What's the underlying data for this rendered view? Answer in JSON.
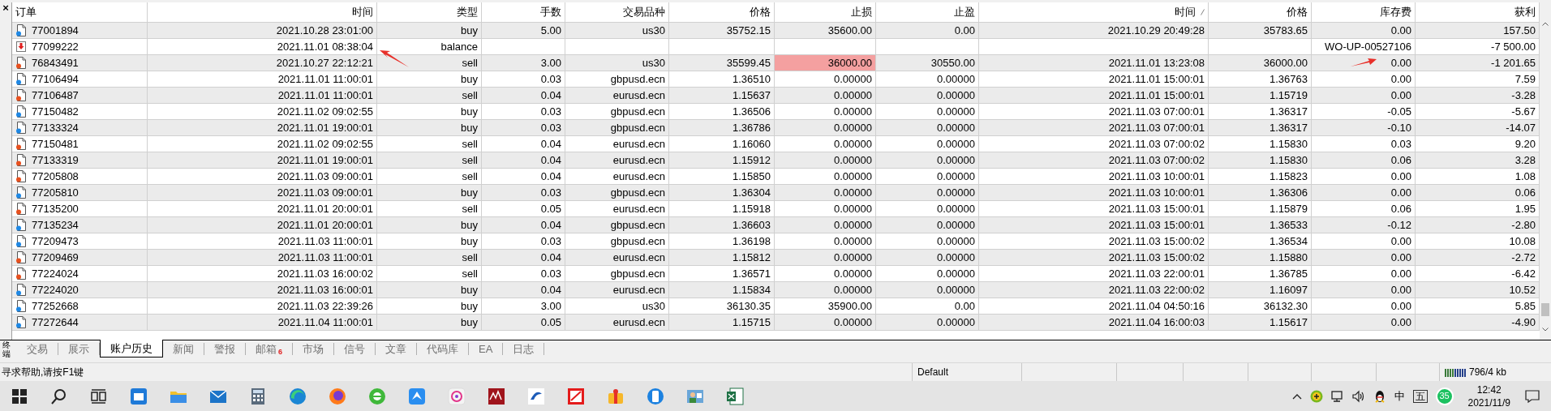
{
  "close_glyph": "×",
  "table": {
    "columns": [
      {
        "label": "订单",
        "sorted": false
      },
      {
        "label": "时间",
        "sorted": false
      },
      {
        "label": "类型",
        "sorted": false
      },
      {
        "label": "手数",
        "sorted": false
      },
      {
        "label": "交易品种",
        "sorted": false
      },
      {
        "label": "价格",
        "sorted": false
      },
      {
        "label": "止损",
        "sorted": false
      },
      {
        "label": "止盈",
        "sorted": false
      },
      {
        "label": "时间",
        "sorted": true
      },
      {
        "label": "价格",
        "sorted": false
      },
      {
        "label": "库存费",
        "sorted": false
      },
      {
        "label": "获利",
        "sorted": false
      }
    ],
    "rows": [
      {
        "kind": "buy",
        "sl_hit": false,
        "order": "77001894",
        "time": "2021.10.28 23:01:00",
        "type": "buy",
        "lots": "5.00",
        "symbol": "us30",
        "price": "35752.15",
        "sl": "35600.00",
        "tp": "0.00",
        "close_time": "2021.10.29 20:49:28",
        "close_price": "35783.65",
        "swap": "0.00",
        "profit": "157.50"
      },
      {
        "kind": "balance",
        "sl_hit": false,
        "order": "77099222",
        "time": "2021.11.01 08:38:04",
        "type": "balance",
        "swap": "WO-UP-00527106",
        "profit": "-7 500.00"
      },
      {
        "kind": "sell",
        "sl_hit": true,
        "order": "76843491",
        "time": "2021.10.27 22:12:21",
        "type": "sell",
        "lots": "3.00",
        "symbol": "us30",
        "price": "35599.45",
        "sl": "36000.00",
        "tp": "30550.00",
        "close_time": "2021.11.01 13:23:08",
        "close_price": "36000.00",
        "swap": "0.00",
        "profit": "-1 201.65"
      },
      {
        "kind": "buy",
        "sl_hit": false,
        "order": "77106494",
        "time": "2021.11.01 11:00:01",
        "type": "buy",
        "lots": "0.03",
        "symbol": "gbpusd.ecn",
        "price": "1.36510",
        "sl": "0.00000",
        "tp": "0.00000",
        "close_time": "2021.11.01 15:00:01",
        "close_price": "1.36763",
        "swap": "0.00",
        "profit": "7.59"
      },
      {
        "kind": "sell",
        "sl_hit": false,
        "order": "77106487",
        "time": "2021.11.01 11:00:01",
        "type": "sell",
        "lots": "0.04",
        "symbol": "eurusd.ecn",
        "price": "1.15637",
        "sl": "0.00000",
        "tp": "0.00000",
        "close_time": "2021.11.01 15:00:01",
        "close_price": "1.15719",
        "swap": "0.00",
        "profit": "-3.28"
      },
      {
        "kind": "buy",
        "sl_hit": false,
        "order": "77150482",
        "time": "2021.11.02 09:02:55",
        "type": "buy",
        "lots": "0.03",
        "symbol": "gbpusd.ecn",
        "price": "1.36506",
        "sl": "0.00000",
        "tp": "0.00000",
        "close_time": "2021.11.03 07:00:01",
        "close_price": "1.36317",
        "swap": "-0.05",
        "profit": "-5.67"
      },
      {
        "kind": "buy",
        "sl_hit": false,
        "order": "77133324",
        "time": "2021.11.01 19:00:01",
        "type": "buy",
        "lots": "0.03",
        "symbol": "gbpusd.ecn",
        "price": "1.36786",
        "sl": "0.00000",
        "tp": "0.00000",
        "close_time": "2021.11.03 07:00:01",
        "close_price": "1.36317",
        "swap": "-0.10",
        "profit": "-14.07"
      },
      {
        "kind": "sell",
        "sl_hit": false,
        "order": "77150481",
        "time": "2021.11.02 09:02:55",
        "type": "sell",
        "lots": "0.04",
        "symbol": "eurusd.ecn",
        "price": "1.16060",
        "sl": "0.00000",
        "tp": "0.00000",
        "close_time": "2021.11.03 07:00:02",
        "close_price": "1.15830",
        "swap": "0.03",
        "profit": "9.20"
      },
      {
        "kind": "sell",
        "sl_hit": false,
        "order": "77133319",
        "time": "2021.11.01 19:00:01",
        "type": "sell",
        "lots": "0.04",
        "symbol": "eurusd.ecn",
        "price": "1.15912",
        "sl": "0.00000",
        "tp": "0.00000",
        "close_time": "2021.11.03 07:00:02",
        "close_price": "1.15830",
        "swap": "0.06",
        "profit": "3.28"
      },
      {
        "kind": "sell",
        "sl_hit": false,
        "order": "77205808",
        "time": "2021.11.03 09:00:01",
        "type": "sell",
        "lots": "0.04",
        "symbol": "eurusd.ecn",
        "price": "1.15850",
        "sl": "0.00000",
        "tp": "0.00000",
        "close_time": "2021.11.03 10:00:01",
        "close_price": "1.15823",
        "swap": "0.00",
        "profit": "1.08"
      },
      {
        "kind": "buy",
        "sl_hit": false,
        "order": "77205810",
        "time": "2021.11.03 09:00:01",
        "type": "buy",
        "lots": "0.03",
        "symbol": "gbpusd.ecn",
        "price": "1.36304",
        "sl": "0.00000",
        "tp": "0.00000",
        "close_time": "2021.11.03 10:00:01",
        "close_price": "1.36306",
        "swap": "0.00",
        "profit": "0.06"
      },
      {
        "kind": "sell",
        "sl_hit": false,
        "order": "77135200",
        "time": "2021.11.01 20:00:01",
        "type": "sell",
        "lots": "0.05",
        "symbol": "eurusd.ecn",
        "price": "1.15918",
        "sl": "0.00000",
        "tp": "0.00000",
        "close_time": "2021.11.03 15:00:01",
        "close_price": "1.15879",
        "swap": "0.06",
        "profit": "1.95"
      },
      {
        "kind": "buy",
        "sl_hit": false,
        "order": "77135234",
        "time": "2021.11.01 20:00:01",
        "type": "buy",
        "lots": "0.04",
        "symbol": "gbpusd.ecn",
        "price": "1.36603",
        "sl": "0.00000",
        "tp": "0.00000",
        "close_time": "2021.11.03 15:00:01",
        "close_price": "1.36533",
        "swap": "-0.12",
        "profit": "-2.80"
      },
      {
        "kind": "buy",
        "sl_hit": false,
        "order": "77209473",
        "time": "2021.11.03 11:00:01",
        "type": "buy",
        "lots": "0.03",
        "symbol": "gbpusd.ecn",
        "price": "1.36198",
        "sl": "0.00000",
        "tp": "0.00000",
        "close_time": "2021.11.03 15:00:02",
        "close_price": "1.36534",
        "swap": "0.00",
        "profit": "10.08"
      },
      {
        "kind": "sell",
        "sl_hit": false,
        "order": "77209469",
        "time": "2021.11.03 11:00:01",
        "type": "sell",
        "lots": "0.04",
        "symbol": "eurusd.ecn",
        "price": "1.15812",
        "sl": "0.00000",
        "tp": "0.00000",
        "close_time": "2021.11.03 15:00:02",
        "close_price": "1.15880",
        "swap": "0.00",
        "profit": "-2.72"
      },
      {
        "kind": "sell",
        "sl_hit": false,
        "order": "77224024",
        "time": "2021.11.03 16:00:02",
        "type": "sell",
        "lots": "0.03",
        "symbol": "gbpusd.ecn",
        "price": "1.36571",
        "sl": "0.00000",
        "tp": "0.00000",
        "close_time": "2021.11.03 22:00:01",
        "close_price": "1.36785",
        "swap": "0.00",
        "profit": "-6.42"
      },
      {
        "kind": "buy",
        "sl_hit": false,
        "order": "77224020",
        "time": "2021.11.03 16:00:01",
        "type": "buy",
        "lots": "0.04",
        "symbol": "eurusd.ecn",
        "price": "1.15834",
        "sl": "0.00000",
        "tp": "0.00000",
        "close_time": "2021.11.03 22:00:02",
        "close_price": "1.16097",
        "swap": "0.00",
        "profit": "10.52"
      },
      {
        "kind": "buy",
        "sl_hit": false,
        "order": "77252668",
        "time": "2021.11.03 22:39:26",
        "type": "buy",
        "lots": "3.00",
        "symbol": "us30",
        "price": "36130.35",
        "sl": "35900.00",
        "tp": "0.00",
        "close_time": "2021.11.04 04:50:16",
        "close_price": "36132.30",
        "swap": "0.00",
        "profit": "5.85"
      },
      {
        "kind": "buy",
        "sl_hit": false,
        "order": "77272644",
        "time": "2021.11.04 11:00:01",
        "type": "buy",
        "lots": "0.05",
        "symbol": "eurusd.ecn",
        "price": "1.15715",
        "sl": "0.00000",
        "tp": "0.00000",
        "close_time": "2021.11.04 16:00:03",
        "close_price": "1.15617",
        "swap": "0.00",
        "profit": "-4.90"
      }
    ]
  },
  "terminal_label": "终端",
  "tabs": [
    {
      "label": "交易",
      "selected": false
    },
    {
      "label": "展示",
      "selected": false
    },
    {
      "label": "账户历史",
      "selected": true
    },
    {
      "label": "新闻",
      "selected": false
    },
    {
      "label": "警报",
      "selected": false
    },
    {
      "label": "邮箱",
      "selected": false,
      "badge": "6"
    },
    {
      "label": "市场",
      "selected": false
    },
    {
      "label": "信号",
      "selected": false
    },
    {
      "label": "文章",
      "selected": false
    },
    {
      "label": "代码库",
      "selected": false
    },
    {
      "label": "EA",
      "selected": false
    },
    {
      "label": "日志",
      "selected": false
    }
  ],
  "status_bar": {
    "help": "寻求帮助,请按F1键",
    "profile": "Default",
    "traffic": "796/4 kb"
  },
  "taskbar": {
    "tray": {
      "language": "中",
      "ime": "五",
      "badge": "35",
      "time": "12:42",
      "date": "2021/11/9"
    }
  }
}
